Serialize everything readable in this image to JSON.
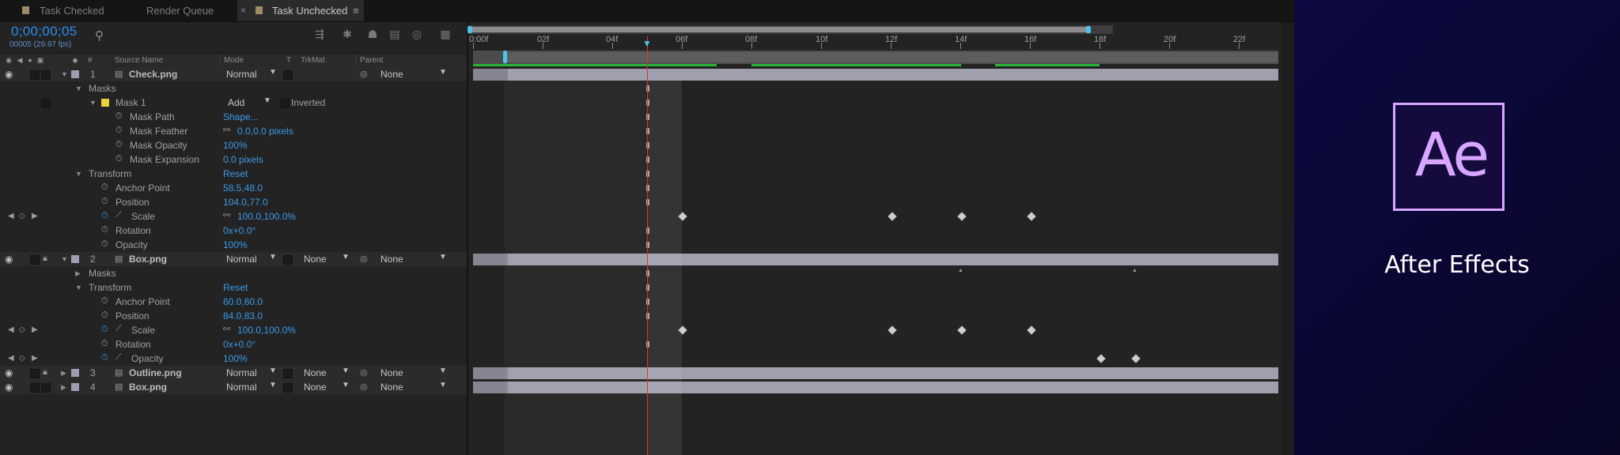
{
  "tabs": [
    {
      "label": "Task Checked"
    },
    {
      "label": "Render Queue"
    },
    {
      "label": "Task Unchecked",
      "close": "×",
      "menu": "≡"
    }
  ],
  "timecode": "0;00;00;05",
  "frame_info": "00005 (29.97 fps)",
  "search_icon": "search-icon",
  "columns": {
    "hash": "#",
    "source_name": "Source Name",
    "mode": "Mode",
    "t": "T",
    "trkmat": "TrkMat",
    "parent": "Parent"
  },
  "layers": [
    {
      "num": "1",
      "name": "Check.png",
      "mode": "Normal",
      "parent": "None",
      "mask": {
        "label": "Masks",
        "name": "Mask 1",
        "mode": "Add",
        "inverted": "Inverted",
        "props": [
          {
            "name": "Mask Path",
            "value": "Shape..."
          },
          {
            "name": "Mask Feather",
            "value": "0.0,0.0 pixels"
          },
          {
            "name": "Mask Opacity",
            "value": "100%"
          },
          {
            "name": "Mask Expansion",
            "value": "0.0 pixels"
          }
        ]
      },
      "transform": {
        "label": "Transform",
        "reset": "Reset",
        "props": [
          {
            "name": "Anchor Point",
            "value": "58.5,48.0"
          },
          {
            "name": "Position",
            "value": "104.0,77.0"
          },
          {
            "name": "Scale",
            "value": "100.0,100.0%"
          },
          {
            "name": "Rotation",
            "value": "0x+0.0°"
          },
          {
            "name": "Opacity",
            "value": "100%"
          }
        ]
      }
    },
    {
      "num": "2",
      "name": "Box.png",
      "mode": "Normal",
      "trkmat": "None",
      "parent": "None",
      "masks_label": "Masks",
      "transform": {
        "label": "Transform",
        "reset": "Reset",
        "props": [
          {
            "name": "Anchor Point",
            "value": "60.0,60.0"
          },
          {
            "name": "Position",
            "value": "84.0,83.0"
          },
          {
            "name": "Scale",
            "value": "100.0,100.0%"
          },
          {
            "name": "Rotation",
            "value": "0x+0.0°"
          },
          {
            "name": "Opacity",
            "value": "100%"
          }
        ]
      }
    },
    {
      "num": "3",
      "name": "Outline.png",
      "mode": "Normal",
      "trkmat": "None",
      "parent": "None"
    },
    {
      "num": "4",
      "name": "Box.png",
      "mode": "Normal",
      "trkmat": "None",
      "parent": "None"
    }
  ],
  "ruler": [
    "0:00f",
    "02f",
    "04f",
    "06f",
    "08f",
    "10f",
    "12f",
    "14f",
    "16f",
    "18f",
    "20f",
    "22f"
  ],
  "colors": {
    "timecode": "#2d8ceb",
    "playhead": "#e0322a",
    "accent": "#4fc3f0",
    "brand_purple": "#d7a6ff"
  },
  "brand": {
    "logo": "Ae",
    "name": "After Effects"
  }
}
